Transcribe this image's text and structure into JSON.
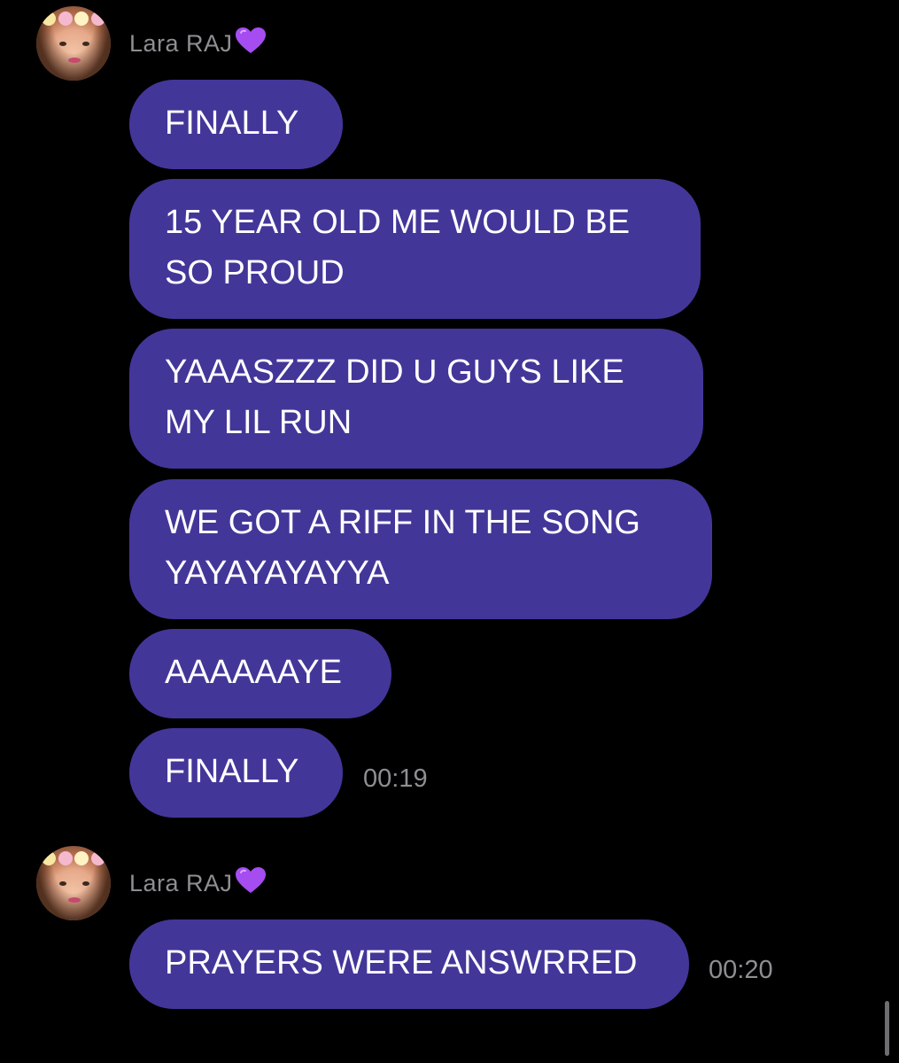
{
  "chat": {
    "groups": [
      {
        "sender": "Lara RAJ",
        "messages": [
          "FINALLY",
          "15 YEAR OLD ME WOULD BE SO PROUD",
          "YAAASZZZ DID U GUYS LIKE MY LIL RUN",
          "WE GOT A RIFF IN THE SONG YAYAYAYAYYA",
          "AAAAAAYE",
          "FINALLY"
        ],
        "timestamp": "00:19"
      },
      {
        "sender": "Lara RAJ",
        "messages": [
          "PRAYERS WERE ANSWRRED"
        ],
        "timestamp": "00:20"
      }
    ]
  },
  "icons": {
    "sender_badge": "purple-heart-icon"
  },
  "colors": {
    "background": "#000000",
    "bubble": "#433699",
    "bubble_text": "#ffffff",
    "meta_text": "#8e8e93",
    "heart": "#a64df2"
  }
}
